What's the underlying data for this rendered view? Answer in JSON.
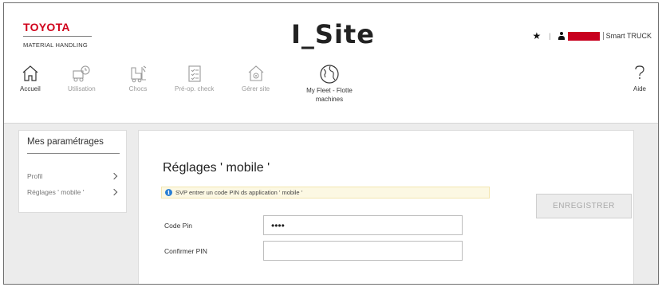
{
  "brand": {
    "name": "TOYOTA",
    "sub": "MATERIAL HANDLING",
    "color": "#d0021b"
  },
  "app_title": "I_Site",
  "topbar": {
    "star_glyph": "★",
    "separator": "|",
    "tenant": "Smart TRUCK"
  },
  "nav": [
    {
      "label": "Accueil",
      "icon": "home-icon",
      "enabled": true
    },
    {
      "label": "Utilisation",
      "icon": "utilization-icon",
      "enabled": false
    },
    {
      "label": "Chocs",
      "icon": "shock-icon",
      "enabled": false
    },
    {
      "label": "Pré-op. check",
      "icon": "checklist-icon",
      "enabled": false
    },
    {
      "label": "Gérer site",
      "icon": "manage-site-icon",
      "enabled": false
    },
    {
      "label": "My Fleet - Flotte machines",
      "icon": "globe-icon",
      "enabled": true
    },
    {
      "label": "Aide",
      "icon": "help-icon",
      "enabled": true
    }
  ],
  "sidebar": {
    "title": "Mes paramétrages",
    "items": [
      {
        "label": "Profil"
      },
      {
        "label": "Réglages ' mobile '"
      }
    ]
  },
  "panel": {
    "title": "Réglages ' mobile '",
    "info_text": "SVP entrer un code PIN ds application ' mobile '",
    "code_pin_label": "Code Pin",
    "code_pin_value": "••••",
    "confirm_label": "Confirmer PIN",
    "confirm_value": "",
    "save_label": "ENREGISTRER"
  },
  "colors": {
    "content_bg": "#ececec",
    "info_bg": "#fcf8e3",
    "redaction": "#c8001e"
  }
}
